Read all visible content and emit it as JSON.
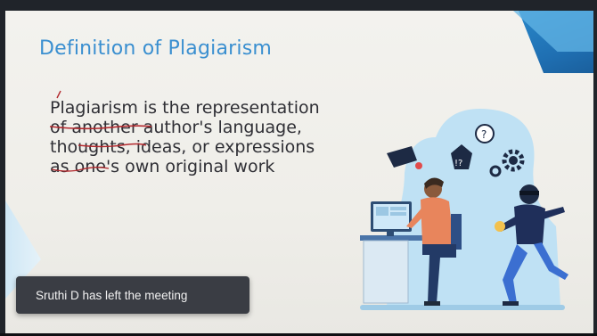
{
  "slide": {
    "title": "Definition of Plagiarism",
    "body_lines": [
      "Plagiarism is the representation",
      "of another author's language,",
      "thoughts, ideas, or expressions",
      "as one's own original work"
    ],
    "illustration": {
      "exclaim_bubble": "!?",
      "question_bubble": "?"
    }
  },
  "notification": {
    "text": "Sruthi D has left the meeting"
  },
  "colors": {
    "title": "#3a8fd0",
    "accent_blue": "#1f6fb2",
    "toast_bg": "#3a3d44",
    "annotation_red": "#b3292e"
  }
}
